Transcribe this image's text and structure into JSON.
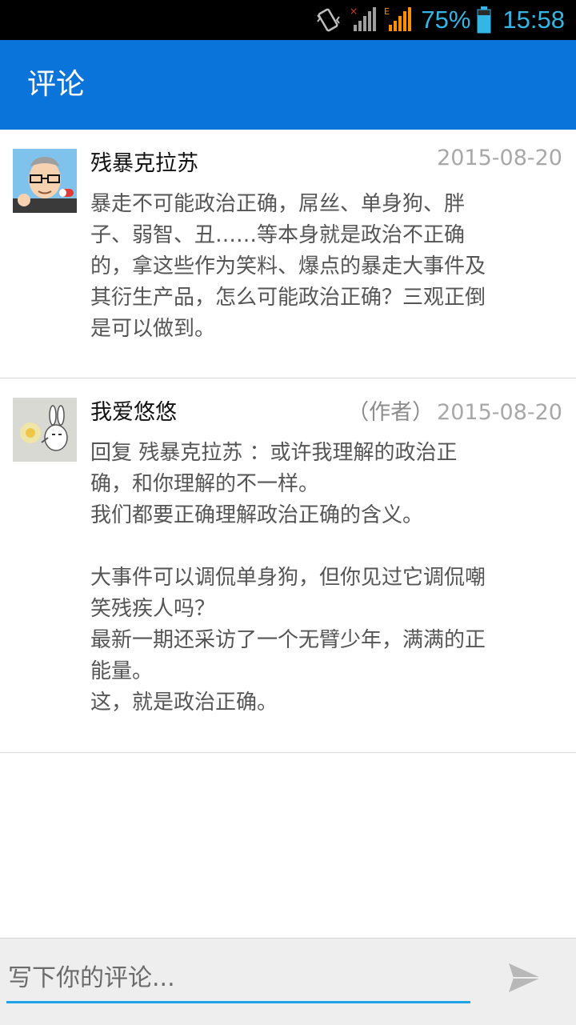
{
  "status_bar": {
    "battery_percent": "75%",
    "clock": "15:58",
    "accent_color": "#33b5e5"
  },
  "app_bar": {
    "title": "评论",
    "color": "#0a74da"
  },
  "comments": [
    {
      "author": "残暴克拉苏",
      "author_tag": "",
      "date": "2015-08-20",
      "text": "暴走不可能政治正确，屌丝、单身狗、胖\n子、弱智、丑……等本身就是政治不正确\n的，拿这些作为笑料、爆点的暴走大事件及\n其衍生产品，怎么可能政治正确？三观正倒\n是可以做到。",
      "avatar_icon": "cartoon-man-avatar"
    },
    {
      "author": "我爱悠悠",
      "author_tag": "（作者）",
      "date": "2015-08-20",
      "text": "回复 残暴克拉苏 ：或许我理解的政治正\n确，和你理解的不一样。\n我们都要正确理解政治正确的含义。\n\n大事件可以调侃单身狗，但你见过它调侃嘲\n笑残疾人吗？\n最新一期还采访了一个无臂少年，满满的正\n能量。\n这，就是政治正确。",
      "avatar_icon": "cartoon-rabbit-avatar"
    }
  ],
  "comment_input": {
    "placeholder": "写下你的评论...",
    "value": ""
  },
  "send": {
    "icon": "send-icon"
  }
}
